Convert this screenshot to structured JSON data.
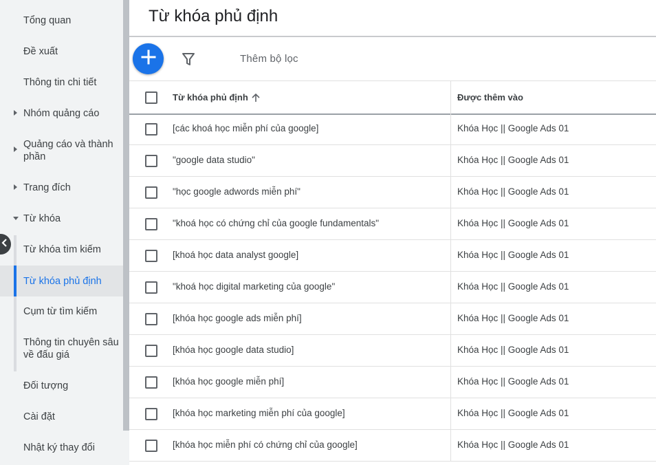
{
  "sidebar": {
    "items": [
      {
        "label": "Tổng quan"
      },
      {
        "label": "Đề xuất"
      },
      {
        "label": "Thông tin chi tiết"
      },
      {
        "label": "Nhóm quảng cáo"
      },
      {
        "label": "Quảng cáo và thành phần"
      },
      {
        "label": "Trang đích"
      },
      {
        "label": "Từ khóa"
      },
      {
        "label": "Từ khóa tìm kiếm"
      },
      {
        "label": "Từ khóa phủ định"
      },
      {
        "label": "Cụm từ tìm kiếm"
      },
      {
        "label": "Thông tin chuyên sâu về đấu giá"
      },
      {
        "label": "Đối tượng"
      },
      {
        "label": "Cài đặt"
      },
      {
        "label": "Nhật ký thay đổi"
      }
    ]
  },
  "page": {
    "title": "Từ khóa phủ định",
    "add_filter_label": "Thêm bộ lọc"
  },
  "table": {
    "columns": [
      "Từ khóa phủ định",
      "Được thêm vào"
    ],
    "rows": [
      {
        "keyword": "[các khoá học miễn phí của google]",
        "added_to": "Khóa Học || Google Ads 01"
      },
      {
        "keyword": "\"google data studio\"",
        "added_to": "Khóa Học || Google Ads 01"
      },
      {
        "keyword": "\"học google adwords miễn phí\"",
        "added_to": "Khóa Học || Google Ads 01"
      },
      {
        "keyword": "\"khoá học có chứng chỉ của google fundamentals\"",
        "added_to": "Khóa Học || Google Ads 01"
      },
      {
        "keyword": "[khoá học data analyst google]",
        "added_to": "Khóa Học || Google Ads 01"
      },
      {
        "keyword": "\"khoá học digital marketing của google\"",
        "added_to": "Khóa Học || Google Ads 01"
      },
      {
        "keyword": "[khóa học google ads miễn phí]",
        "added_to": "Khóa Học || Google Ads 01"
      },
      {
        "keyword": "[khóa học google data studio]",
        "added_to": "Khóa Học || Google Ads 01"
      },
      {
        "keyword": "[khóa học google miễn phí]",
        "added_to": "Khóa Học || Google Ads 01"
      },
      {
        "keyword": "[khóa học marketing miễn phí của google]",
        "added_to": "Khóa Học || Google Ads 01"
      },
      {
        "keyword": "[khóa học miễn phí có chứng chỉ của google]",
        "added_to": "Khóa Học || Google Ads 01"
      }
    ]
  },
  "icons": {
    "fab": "plus-icon",
    "filter": "filter-icon",
    "sort": "arrow-up-icon",
    "collapse": "close-icon"
  },
  "colors": {
    "accent": "#1a73e8",
    "sidebar_bg": "#f1f3f4"
  }
}
